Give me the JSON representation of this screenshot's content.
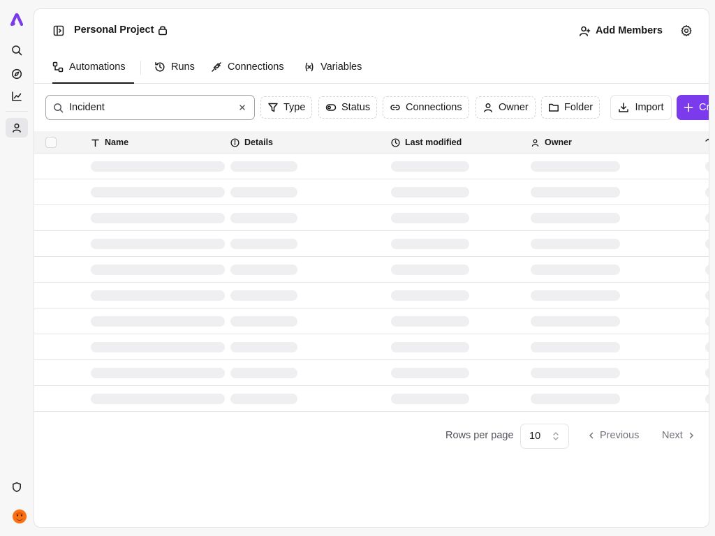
{
  "header": {
    "project_title": "Personal Project",
    "add_members_label": "Add Members"
  },
  "tabs": [
    {
      "label": "Automations",
      "icon": "automations-icon",
      "active": true
    },
    {
      "label": "Runs",
      "icon": "history-icon"
    },
    {
      "label": "Connections",
      "icon": "plug-icon"
    },
    {
      "label": "Variables",
      "icon": "variable-icon"
    }
  ],
  "toolbar": {
    "search_value": "Incident",
    "filters": [
      {
        "label": "Type",
        "icon": "filter-icon"
      },
      {
        "label": "Status",
        "icon": "toggle-icon"
      },
      {
        "label": "Connections",
        "icon": "link-icon"
      },
      {
        "label": "Owner",
        "icon": "user-icon"
      },
      {
        "label": "Folder",
        "icon": "folder-icon"
      }
    ],
    "import_label": "Import",
    "create_label": "Cr"
  },
  "table": {
    "columns": [
      {
        "label": "Name",
        "icon": "text-icon"
      },
      {
        "label": "Details",
        "icon": "info-icon"
      },
      {
        "label": "Last modified",
        "icon": "clock-icon"
      },
      {
        "label": "Owner",
        "icon": "user-icon"
      }
    ],
    "loading_rows": 10
  },
  "pagination": {
    "rows_per_page_label": "Rows per page",
    "rows_per_page_value": "10",
    "previous_label": "Previous",
    "next_label": "Next"
  },
  "colors": {
    "accent": "#7c3aed",
    "logo": "#7c3aed",
    "avatar": "#f97316"
  }
}
